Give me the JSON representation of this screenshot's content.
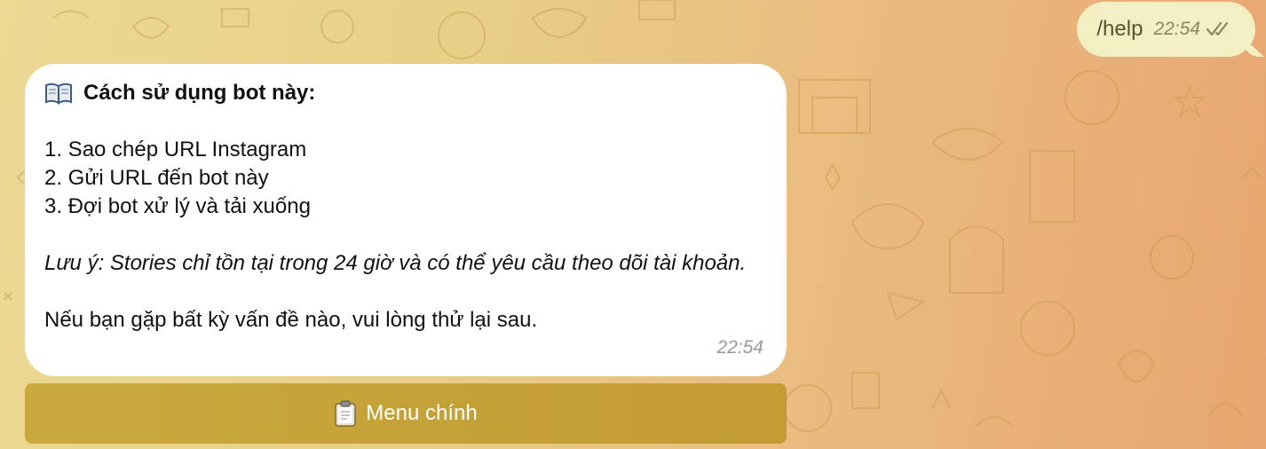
{
  "chat": {
    "outgoing": {
      "text": "/help",
      "time": "22:54",
      "status_icon": "double-check-icon"
    },
    "incoming": {
      "title_icon": "open-book-icon",
      "title": "Cách sử dụng bot này:",
      "steps": [
        "1. Sao chép URL Instagram",
        "2. Gửi URL đến bot này",
        "3. Đợi bot xử lý và tải xuống"
      ],
      "note": "Lưu ý: Stories chỉ tồn tại trong 24 giờ và có thể yêu cầu theo dõi tài khoản.",
      "footer": "Nếu bạn gặp bất kỳ vấn đề nào, vui lòng thử lại sau.",
      "time": "22:54"
    },
    "keyboard": {
      "button_icon": "clipboard-icon",
      "button_label": "Menu chính"
    }
  },
  "colors": {
    "background_start": "#ecd993",
    "background_end": "#e7a66f",
    "outgoing_bubble": "#f4efc2",
    "incoming_bubble": "#ffffff",
    "keyboard_button": "#c5a338"
  }
}
